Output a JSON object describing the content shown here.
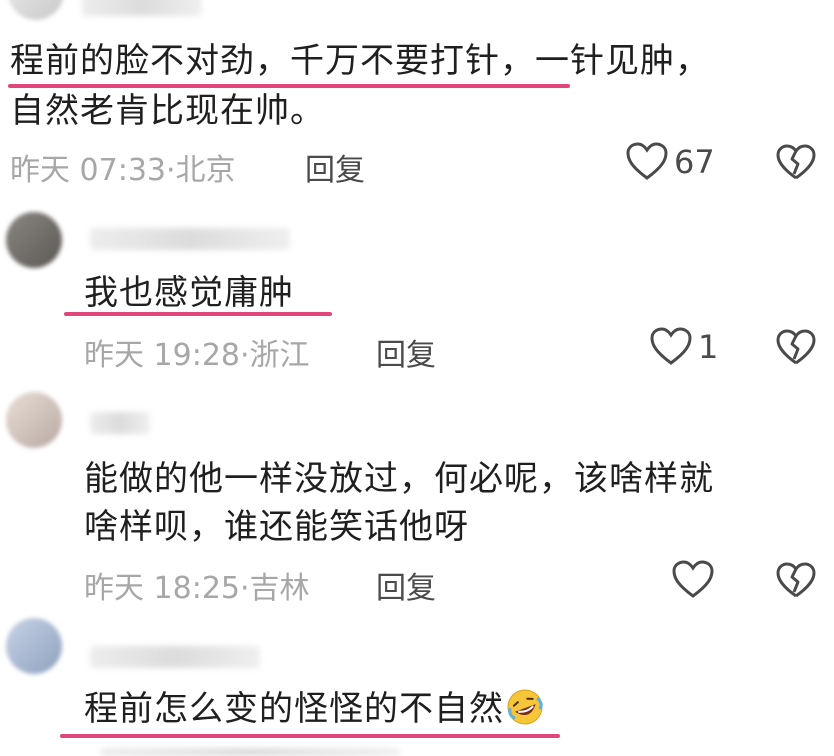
{
  "comments": [
    {
      "lines": [
        "程前的脸不对劲，千万不要打针，一针见肿，",
        "自然老肯比现在帅。"
      ],
      "time": "昨天 07:33",
      "location": "北京",
      "reply_label": "回复",
      "likes": "67"
    },
    {
      "lines": [
        "我也感觉庸肿"
      ],
      "time": "昨天 19:28",
      "location": "浙江",
      "reply_label": "回复",
      "likes": "1"
    },
    {
      "lines": [
        "能做的他一样没放过，何必呢，该啥样就",
        "啥样呗，谁还能笑话他呀"
      ],
      "time": "昨天 18:25",
      "location": "吉林",
      "reply_label": "回复",
      "likes": ""
    },
    {
      "lines": [
        "程前怎么变的怪怪的不自然"
      ],
      "emoji": "rofl-emoji"
    }
  ],
  "icons": {
    "like": "heart-icon",
    "dislike": "broken-heart-icon"
  },
  "colors": {
    "underline": "#e0467c",
    "meta": "#a7a7a7"
  }
}
